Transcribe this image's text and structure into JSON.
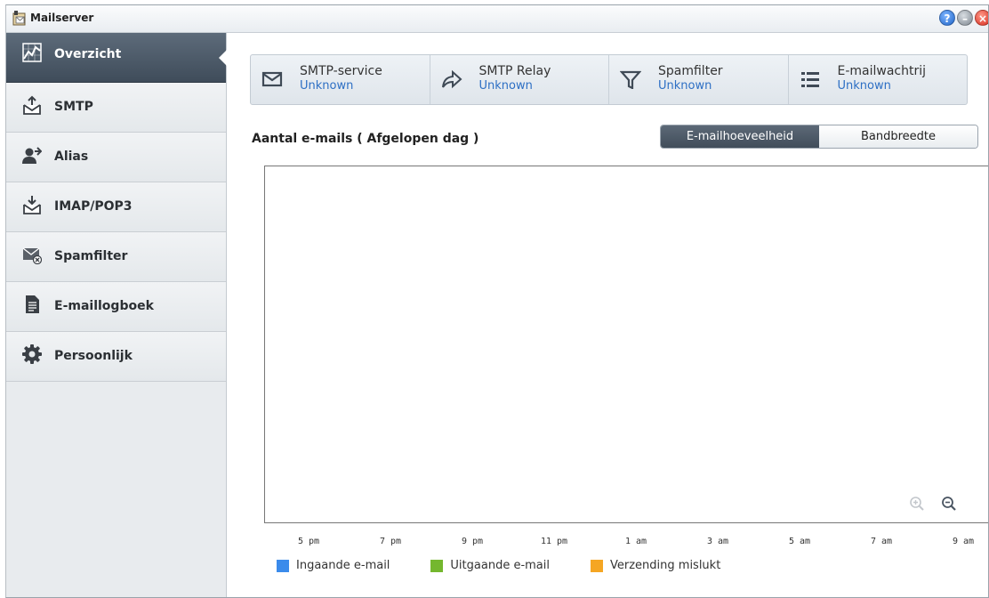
{
  "window": {
    "title": "Mailserver"
  },
  "sidebar": {
    "items": [
      {
        "label": "Overzicht",
        "icon": "chart-icon"
      },
      {
        "label": "SMTP",
        "icon": "mail-upload-icon"
      },
      {
        "label": "Alias",
        "icon": "user-forward-icon"
      },
      {
        "label": "IMAP/POP3",
        "icon": "mail-download-icon"
      },
      {
        "label": "Spamfilter",
        "icon": "spam-mail-icon"
      },
      {
        "label": "E-maillogboek",
        "icon": "document-icon"
      },
      {
        "label": "Persoonlijk",
        "icon": "gear-icon"
      }
    ]
  },
  "status": [
    {
      "name": "SMTP-service",
      "value": "Unknown",
      "icon": "envelope-icon"
    },
    {
      "name": "SMTP Relay",
      "value": "Unknown",
      "icon": "forward-arrow-icon"
    },
    {
      "name": "Spamfilter",
      "value": "Unknown",
      "icon": "filter-icon"
    },
    {
      "name": "E-mailwachtrij",
      "value": "Unknown",
      "icon": "list-icon"
    }
  ],
  "chart": {
    "title": "Aantal e-mails ( Afgelopen dag )",
    "tabs": {
      "active": "E-mailhoeveelheid",
      "inactive": "Bandbreedte"
    }
  },
  "chart_data": {
    "type": "line",
    "title": "Aantal e-mails ( Afgelopen dag )",
    "x": [
      "5 pm",
      "7 pm",
      "9 pm",
      "11 pm",
      "1 am",
      "3 am",
      "5 am",
      "7 am",
      "9 am"
    ],
    "series": [
      {
        "name": "Ingaande e-mail",
        "color": "#3b8beb",
        "values": []
      },
      {
        "name": "Uitgaande e-mail",
        "color": "#74b72e",
        "values": []
      },
      {
        "name": "Verzending mislukt",
        "color": "#f5a623",
        "values": []
      }
    ],
    "legend_position": "bottom"
  },
  "colors": {
    "accent": "#2d6fc4",
    "sidebar_active": "#46525f"
  }
}
